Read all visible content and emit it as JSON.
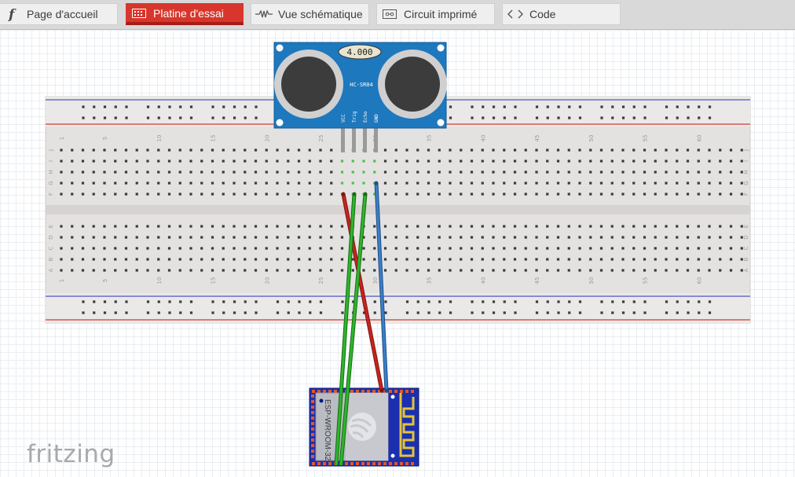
{
  "tabs": [
    {
      "label": "Page d'accueil",
      "icon": "fritzing-f-icon",
      "active": false
    },
    {
      "label": "Platine d'essai",
      "icon": "breadboard-icon",
      "active": true
    },
    {
      "label": "Vue schématique",
      "icon": "resistor-icon",
      "active": false
    },
    {
      "label": "Circuit imprimé",
      "icon": "pcb-icon",
      "active": false
    },
    {
      "label": "Code",
      "icon": "code-icon",
      "active": false
    }
  ],
  "breadboard": {
    "column_numbers": [
      "1",
      "5",
      "10",
      "15",
      "20",
      "25",
      "30",
      "35",
      "40",
      "45",
      "50",
      "55",
      "60"
    ],
    "top_row_letters": [
      "J",
      "I",
      "H",
      "G",
      "F"
    ],
    "bottom_row_letters": [
      "E",
      "D",
      "C",
      "B",
      "A"
    ]
  },
  "sensor": {
    "display": "4.000",
    "model": "HC-SR04",
    "pins": [
      "VCC",
      "Trig",
      "Echo",
      "GND"
    ]
  },
  "module": {
    "label": "ESP-WROOM-32"
  },
  "logo": "fritzing",
  "colors": {
    "active_tab": "#d8362c",
    "sensor_blue": "#1e78bd",
    "wire_red": "#c8241c",
    "wire_green": "#2fb52c",
    "wire_blue": "#3a7fc8",
    "esp_board": "#1b2fb0"
  }
}
